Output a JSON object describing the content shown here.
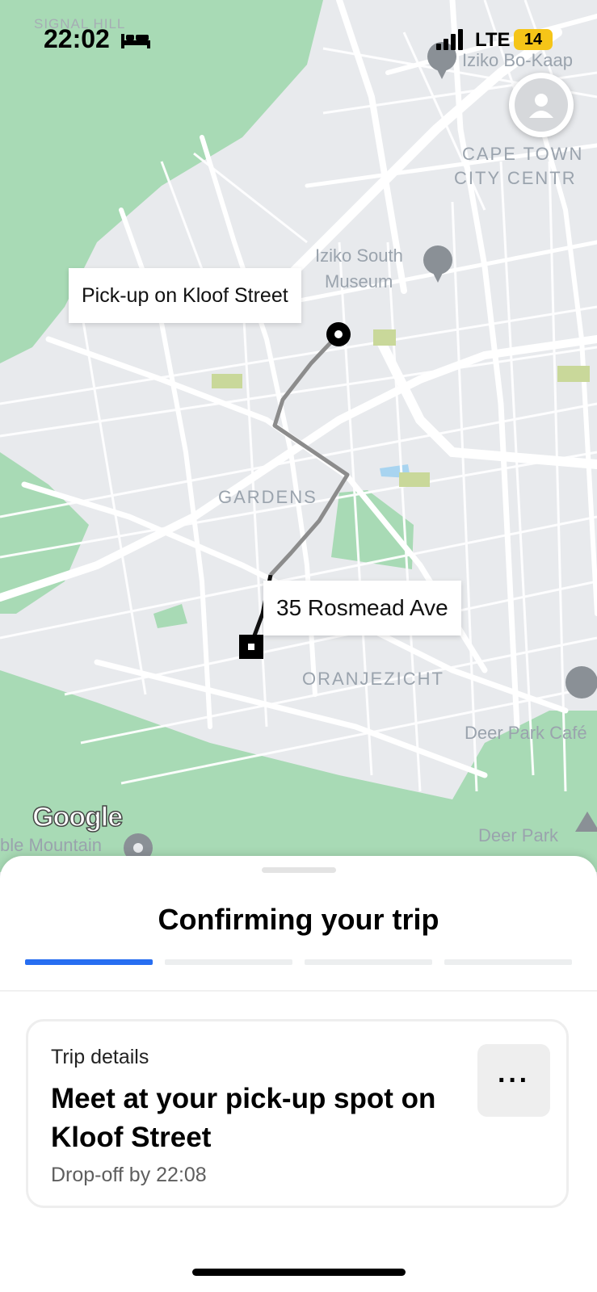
{
  "status_bar": {
    "time": "22:02",
    "network": "LTE",
    "battery": "14"
  },
  "map": {
    "labels": {
      "signal_hill": "SIGNAL HILL",
      "cape_town_1": "CAPE TOWN",
      "cape_town_2": "CITY CENTR",
      "gardens": "GARDENS",
      "oranjezicht": "ORANJEZICHT"
    },
    "pois": {
      "iziko_bokaap": "Iziko Bo-Kaap",
      "iziko_south_1": "Iziko South",
      "iziko_south_2": "Museum",
      "deer_park_cafe": "Deer Park Café",
      "deer_park": "Deer Park",
      "table_mountain": "ble Mountain"
    },
    "google": "Google",
    "pickup_callout": "Pick-up on Kloof Street",
    "dropoff_callout": "35 Rosmead Ave"
  },
  "sheet": {
    "title": "Confirming your trip",
    "card": {
      "label": "Trip details",
      "title": "Meet at your pick-up spot on Kloof Street",
      "subtitle": "Drop-off by 22:08",
      "more": "···"
    }
  },
  "colors": {
    "progress_active": "#276ef1",
    "progress_inactive": "#eceeef",
    "map_green": "#a8dab5",
    "route": "#8c8c8c"
  }
}
